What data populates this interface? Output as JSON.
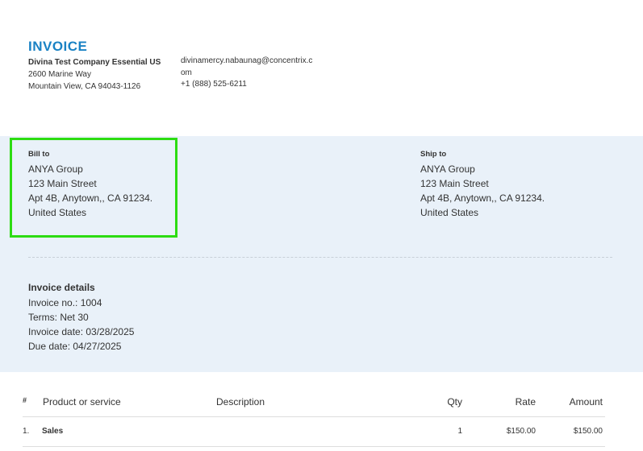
{
  "invoice": {
    "title": "INVOICE",
    "company_name": "Divina Test Company Essential US",
    "company_address_1": "2600 Marine Way",
    "company_address_2": "Mountain View, CA 94043-1126",
    "email": "divinamercy.nabaunag@concentrix.com",
    "phone": "+1 (888) 525-6211"
  },
  "bill_to": {
    "label": "Bill to",
    "lines": [
      "ANYA Group",
      "123 Main Street",
      "Apt 4B, Anytown,, CA 91234.",
      "United States"
    ]
  },
  "ship_to": {
    "label": "Ship to",
    "lines": [
      "ANYA Group",
      "123 Main Street",
      "Apt 4B, Anytown,, CA 91234.",
      "United States"
    ]
  },
  "details": {
    "heading": "Invoice details",
    "invoice_no": "Invoice no.: 1004",
    "terms": "Terms: Net 30",
    "invoice_date": "Invoice date: 03/28/2025",
    "due_date": "Due date: 04/27/2025"
  },
  "table": {
    "headers": {
      "num": "#",
      "product": "Product or service",
      "description": "Description",
      "qty": "Qty",
      "rate": "Rate",
      "amount": "Amount"
    },
    "rows": [
      {
        "num": "1.",
        "product": "Sales",
        "description": "",
        "qty": "1",
        "rate": "$150.00",
        "amount": "$150.00"
      }
    ]
  },
  "colors": {
    "accent": "#1a82c4",
    "band": "#e9f1f9",
    "highlight": "#2ddc12"
  }
}
